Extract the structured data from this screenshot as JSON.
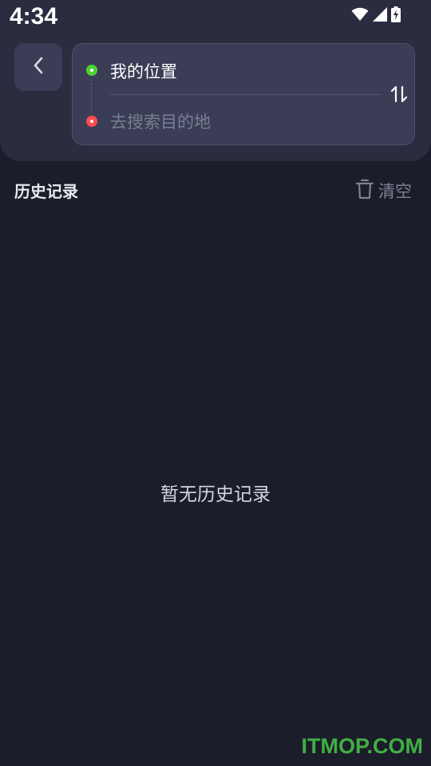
{
  "status_bar": {
    "time": "4:34",
    "icons": [
      "wifi-icon",
      "signal-icon",
      "battery-charging-icon"
    ]
  },
  "header": {
    "back_icon": "chevron-left-icon",
    "origin": {
      "label": "我的位置",
      "dot_color": "#4cd137"
    },
    "destination": {
      "value": "",
      "placeholder": "去搜索目的地",
      "dot_color": "#ff4d4f"
    },
    "swap_icon": "swap-vertical-icon"
  },
  "history": {
    "title": "历史记录",
    "clear_label": "清空",
    "clear_icon": "trash-icon",
    "empty_text": "暂无历史记录"
  },
  "watermark": "ITMOP.COM",
  "colors": {
    "background": "#1c1d2a",
    "header_bg": "#2a2c3f",
    "card_bg": "#3a3d55",
    "watermark": "#3fb043"
  }
}
